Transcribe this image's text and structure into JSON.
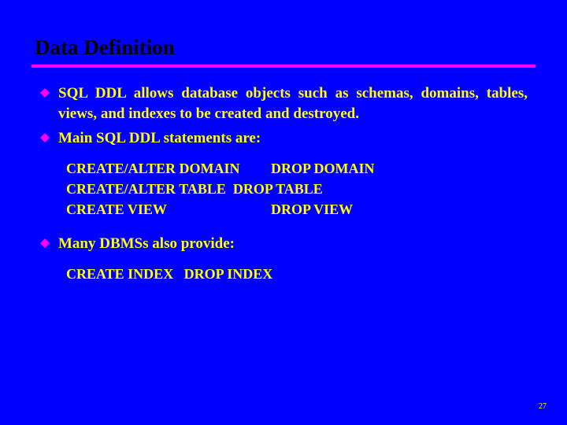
{
  "slide": {
    "title": "Data Definition",
    "page_number": "27"
  },
  "bullets": {
    "item1": "SQL DDL allows database objects such as schemas, domains, tables, views, and indexes to be created and destroyed.",
    "item2": "Main SQL DDL statements are:",
    "item3": "Many DBMSs also provide:"
  },
  "statements_a": {
    "row1_col1": "CREATE/ALTER DOMAIN",
    "row1_col2": "DROP DOMAIN",
    "row2": "CREATE/ALTER TABLE  DROP TABLE",
    "row3_col1": "CREATE VIEW",
    "row3_col2": "DROP VIEW"
  },
  "statements_b": {
    "row1": "CREATE INDEX   DROP INDEX"
  },
  "colors": {
    "background": "#0000FF",
    "title": "#000000",
    "underline": "#FF00FF",
    "body_text": "#FFFF00",
    "bullet": "#FF00FF"
  }
}
